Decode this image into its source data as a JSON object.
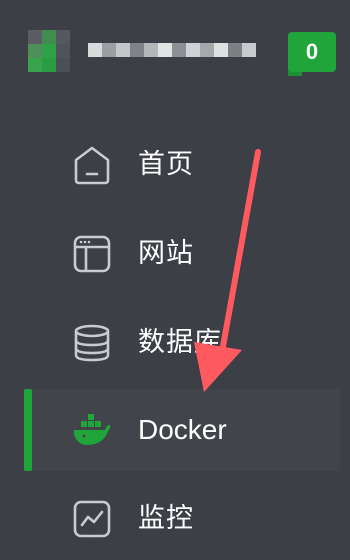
{
  "header": {
    "badge_count": "0"
  },
  "menu": {
    "items": [
      {
        "label": "首页",
        "icon": "home-icon"
      },
      {
        "label": "网站",
        "icon": "website-icon"
      },
      {
        "label": "数据库",
        "icon": "database-icon"
      },
      {
        "label": "Docker",
        "icon": "docker-icon"
      },
      {
        "label": "监控",
        "icon": "monitor-icon"
      }
    ],
    "active_index": 3
  },
  "colors": {
    "background": "#3c3f46",
    "active_background": "#41444b",
    "accent": "#20a53a",
    "icon_stroke": "#c9cbcf",
    "annotation_arrow": "#ff5a5f"
  }
}
